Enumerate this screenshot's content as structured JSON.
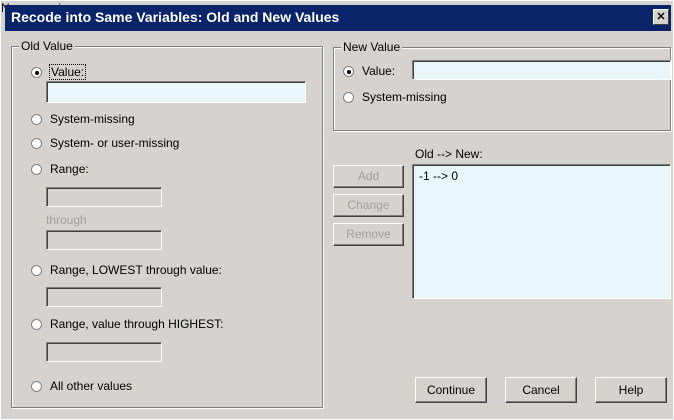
{
  "window": {
    "title": "Recode into Same Variables: Old and New Values",
    "close_glyph": "✕"
  },
  "old_value": {
    "legend": "Old Value",
    "value_label": "Value:",
    "value_input": "",
    "system_missing_label": "System-missing",
    "system_or_user_missing_label": "System- or user-missing",
    "range_label": "Range:",
    "range_through_label": "through",
    "range_lowest_label": "Range, LOWEST through value:",
    "range_highest_label": "Range, value through HIGHEST:",
    "all_other_label": "All other values",
    "selected": "value"
  },
  "new_value": {
    "legend": "New Value",
    "value_label": "Value:",
    "value_input": "",
    "system_missing_label": "System-missing",
    "selected": "value"
  },
  "mapping": {
    "label": "Old --> New:",
    "items": [
      "-1 --> 0"
    ]
  },
  "buttons": {
    "add": "Add",
    "change": "Change",
    "remove": "Remove",
    "continue": "Continue",
    "cancel": "Cancel",
    "help": "Help"
  }
}
